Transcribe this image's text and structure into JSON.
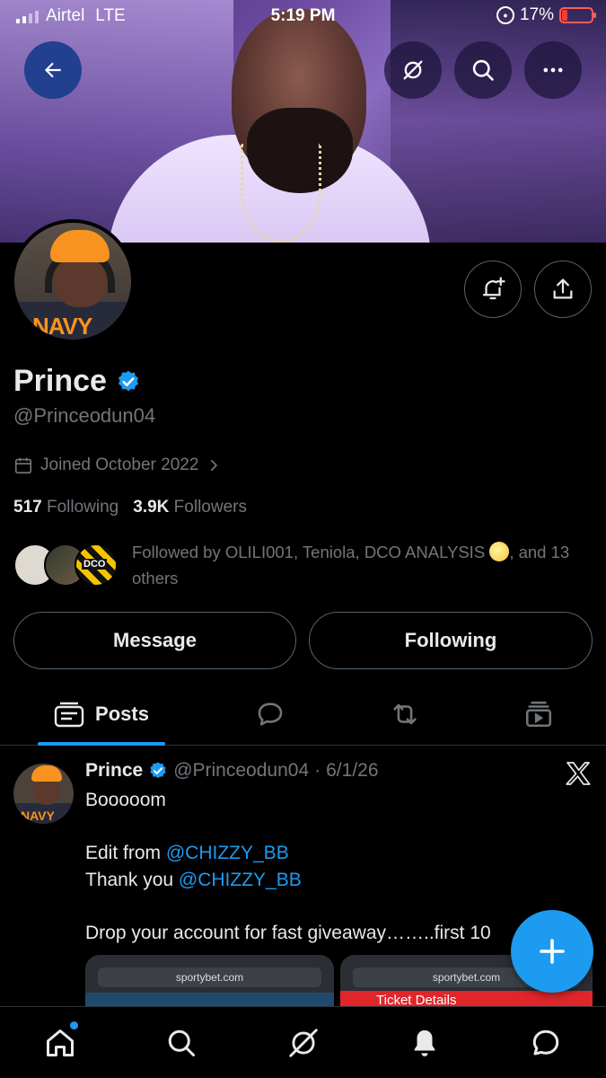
{
  "status_bar": {
    "carrier": "Airtel",
    "network": "LTE",
    "time": "5:19 PM",
    "battery": "17%",
    "battery_level": 0.17
  },
  "profile": {
    "name": "Prince",
    "verified": true,
    "handle": "@Princeodun04",
    "joined": "Joined October 2022",
    "following_count": "517",
    "following_label": "Following",
    "followers_count": "3.9K",
    "followers_label": "Followers",
    "followed_by_pre": "Followed by OLILI001, Teniola, DCO ANALYSIS",
    "followed_by_post": ", and 13 others",
    "avatar_print": "NAVY",
    "follower_avatar_text": "DCO"
  },
  "actions": {
    "message_label": "Message",
    "following_label": "Following"
  },
  "tabs": {
    "posts_label": "Posts"
  },
  "post": {
    "name": "Prince",
    "handle": "@Princeodun04",
    "separator": "·",
    "date": "6/1/26",
    "line1": "Booooom",
    "line2_pre": "Edit from ",
    "line2_mention": "@CHIZZY_BB",
    "line3_pre": "Thank you ",
    "line3_mention": "@CHIZZY_BB",
    "line4": "Drop your account for fast giveaway……..first 10",
    "media_left_url": "sportybet.com",
    "media_right_url": "sportybet.com",
    "media_right_header": "Ticket Details",
    "avatar_print": "NAVY"
  },
  "colors": {
    "accent": "#1d9bf0",
    "background": "#000000",
    "secondary_text": "#71767b",
    "primary_text": "#e7e9ea"
  },
  "icons": {
    "back": "arrow-left-icon",
    "grok": "grok-icon",
    "search": "search-icon",
    "more": "more-icon",
    "notify": "bell-plus-icon",
    "share": "share-icon"
  }
}
